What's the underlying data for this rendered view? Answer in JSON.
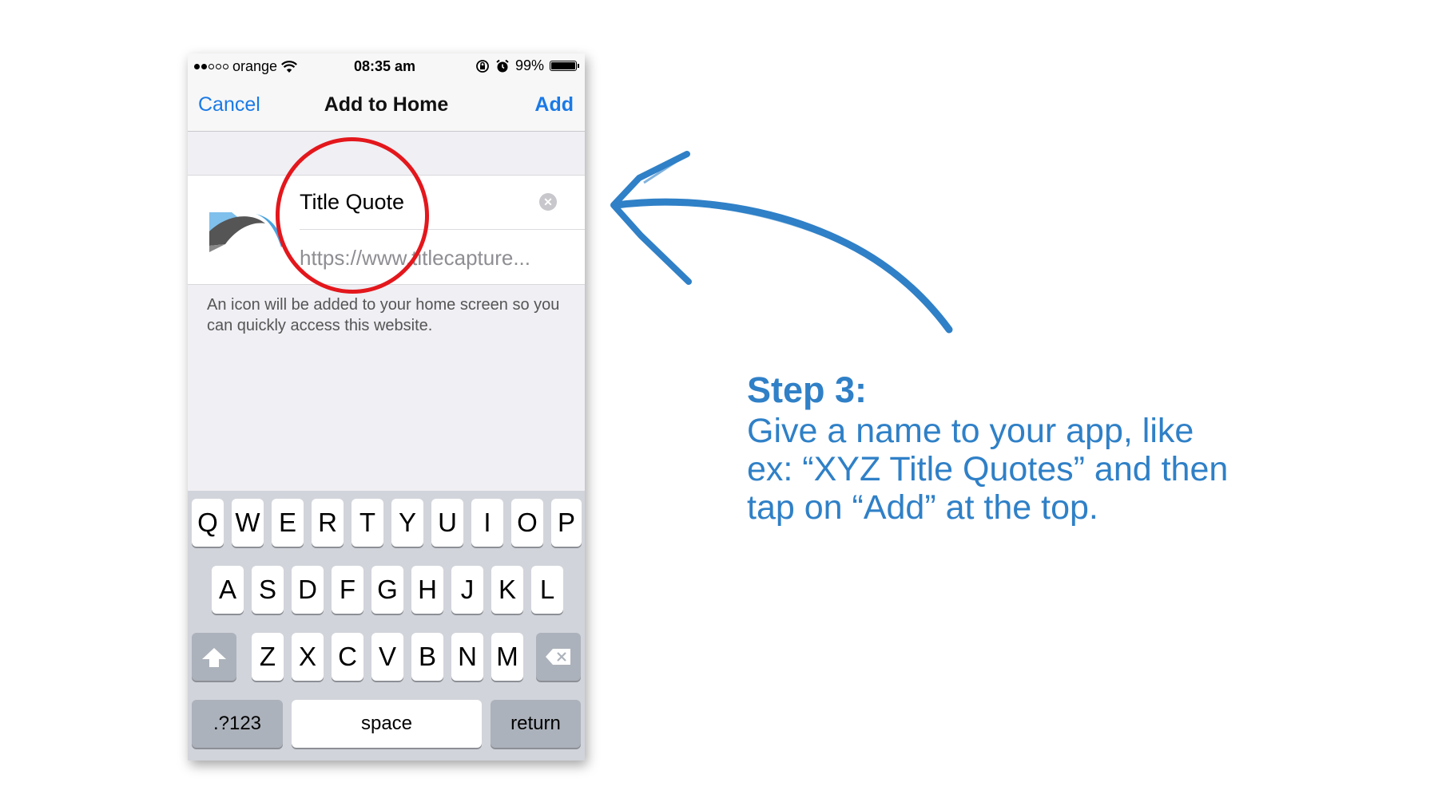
{
  "status_bar": {
    "carrier": "orange",
    "time": "08:35 am",
    "battery": "99%"
  },
  "nav": {
    "cancel": "Cancel",
    "title": "Add to Home",
    "add": "Add"
  },
  "bookmark": {
    "name": "Title Quote",
    "url": "https://www.titlecapture..."
  },
  "description": "An icon will be added to your home screen so you can quickly access this website.",
  "keyboard": {
    "row1": [
      "Q",
      "W",
      "E",
      "R",
      "T",
      "Y",
      "U",
      "I",
      "O",
      "P"
    ],
    "row2": [
      "A",
      "S",
      "D",
      "F",
      "G",
      "H",
      "J",
      "K",
      "L"
    ],
    "row3": [
      "Z",
      "X",
      "C",
      "V",
      "B",
      "N",
      "M"
    ],
    "numbers": ".?123",
    "space": "space",
    "return": "return"
  },
  "instruction": {
    "heading": "Step 3:",
    "line1": "Give a name to your app, like",
    "line2": "ex: “XYZ Title Quotes” and then",
    "line3": "tap on “Add” at the top."
  },
  "colors": {
    "ios_blue": "#1a7ae6",
    "annotation_red": "#e3171c",
    "instruction_blue": "#2f80c7"
  }
}
